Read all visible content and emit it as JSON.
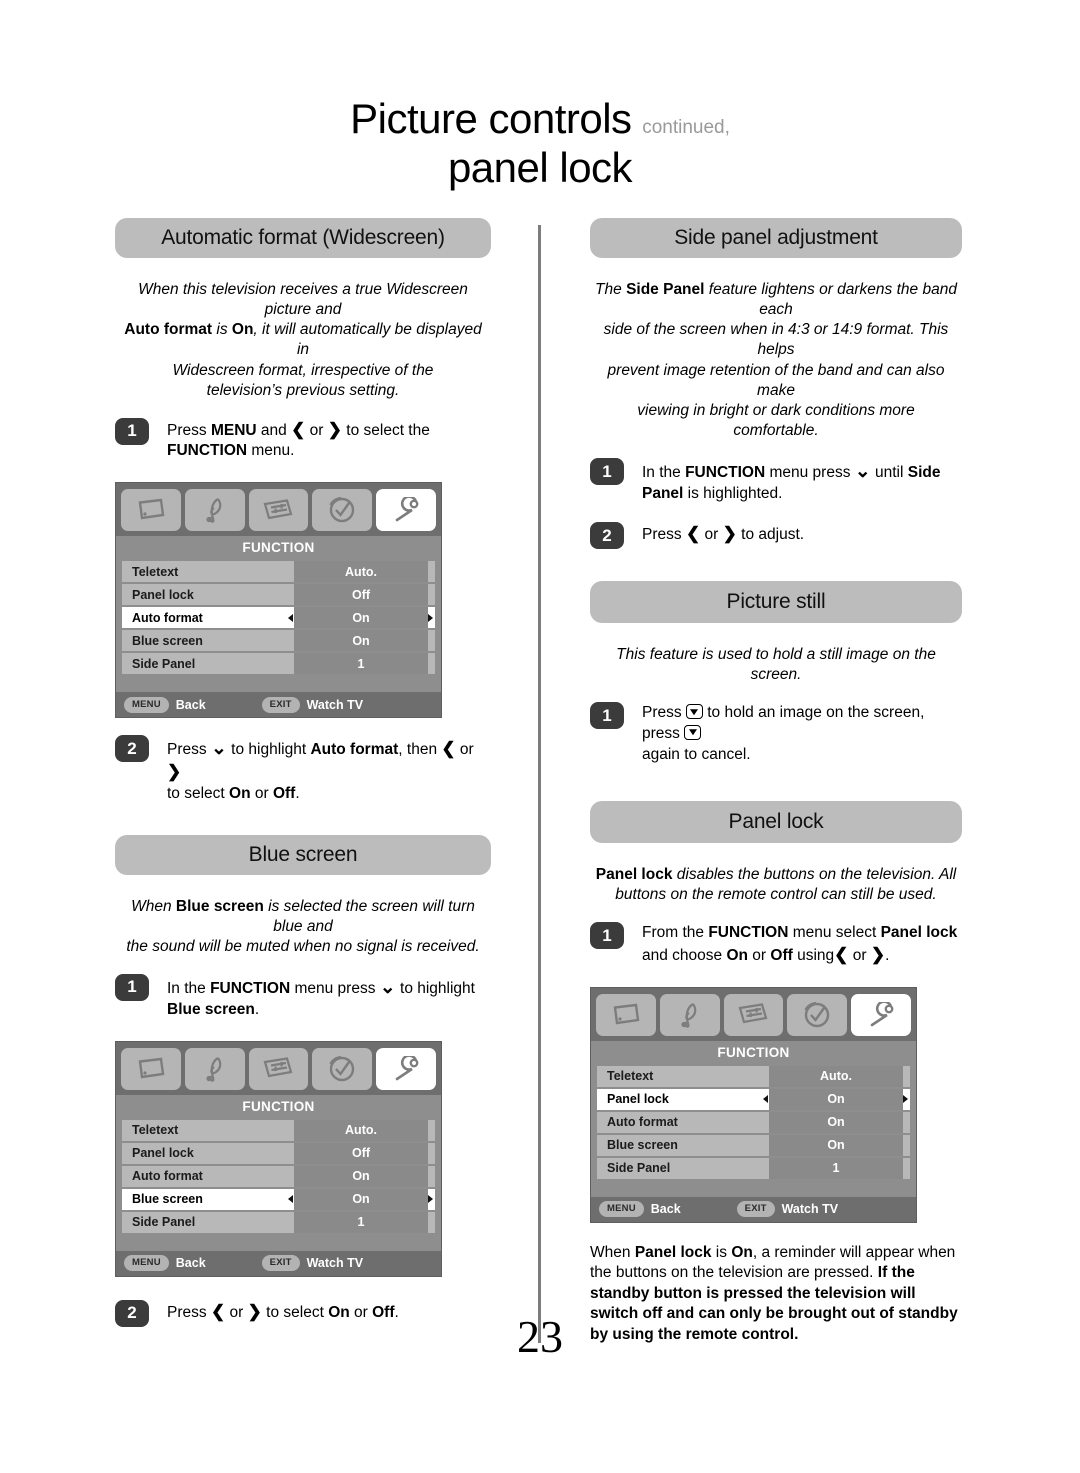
{
  "header": {
    "title_main": "Picture controls",
    "title_continued": "continued,",
    "title_sub": "panel lock"
  },
  "page_number": "23",
  "left_column": {
    "section_auto_format": {
      "heading": "Automatic format (Widescreen)",
      "intro_l1": "When this television receives a true Widescreen picture and",
      "intro_l2_b1": "Auto format",
      "intro_l2_m1": " is ",
      "intro_l2_b2": "On",
      "intro_l2_rest": ", it will automatically be displayed in",
      "intro_l3": "Widescreen format, irrespective of the",
      "intro_l4": "television’s previous setting.",
      "step1_num": "1",
      "step1_t1": "Press ",
      "step1_b1": "MENU",
      "step1_t2": " and ",
      "step1_t3": " or ",
      "step1_t4": " to select the",
      "step1_b2": "FUNCTION",
      "step1_t5": " menu.",
      "step2_num": "2",
      "step2_t1": "Press ",
      "step2_t2": " to highlight ",
      "step2_b1": "Auto format",
      "step2_t3": ", then ",
      "step2_t4": " or ",
      "step2_t5": "to select ",
      "step2_b2": "On",
      "step2_t6": " or ",
      "step2_b3": "Off",
      "step2_t7": "."
    },
    "section_blue_screen": {
      "heading": "Blue screen",
      "intro_l1a": "When ",
      "intro_l1b": "Blue screen",
      "intro_l1c": " is selected the screen will turn blue and",
      "intro_l2": "the sound will be muted when no signal is received.",
      "step1_num": "1",
      "step1_t1": "In the ",
      "step1_b1": "FUNCTION",
      "step1_t2": " menu press ",
      "step1_t3": " to highlight",
      "step1_b2": "Blue screen",
      "step1_t4": ".",
      "step2_num": "2",
      "step2_t1": "Press ",
      "step2_t2": " or ",
      "step2_t3": " to select ",
      "step2_b1": "On",
      "step2_t4": " or ",
      "step2_b2": "Off",
      "step2_t5": "."
    }
  },
  "right_column": {
    "section_side_panel": {
      "heading": "Side panel adjustment",
      "intro_l1a": "The ",
      "intro_l1b": "Side Panel",
      "intro_l1c": " feature lightens or darkens the band each",
      "intro_l2": "side of the screen when in 4:3 or 14:9 format. This helps",
      "intro_l3": "prevent image retention of the band and can also make",
      "intro_l4": "viewing in bright or dark conditions more comfortable.",
      "step1_num": "1",
      "step1_t1": "In the ",
      "step1_b1": "FUNCTION",
      "step1_t2": " menu press ",
      "step1_t3": " until ",
      "step1_b2": "Side",
      "step1_b3": "Panel",
      "step1_t4": " is highlighted.",
      "step2_num": "2",
      "step2_t1": "Press ",
      "step2_t2": " or ",
      "step2_t3": " to adjust."
    },
    "section_picture_still": {
      "heading": "Picture still",
      "intro_l1": "This feature is used to hold a still image on the screen.",
      "step1_num": "1",
      "step1_t1": "Press ",
      "step1_t2": " to hold an image on the screen, press ",
      "step1_t3": "again to cancel."
    },
    "section_panel_lock": {
      "heading": "Panel lock",
      "intro_l1a": "Panel lock",
      "intro_l1b": " disables the buttons on the television. All",
      "intro_l2": "buttons on the remote control can still be used.",
      "step1_num": "1",
      "step1_t1": "From the ",
      "step1_b1": "FUNCTION",
      "step1_t2": " menu select ",
      "step1_b2": "Panel lock",
      "step1_t3": "and choose ",
      "step1_b3": "On",
      "step1_t4": " or ",
      "step1_b4": "Off",
      "step1_t5": " using",
      "step1_t6": " or ",
      "step1_t7": ".",
      "note_t1": "When ",
      "note_b1": "Panel lock",
      "note_t2": " is ",
      "note_b2": "On",
      "note_t3": ", a reminder will appear when",
      "note_t4": "the buttons on the television are pressed. ",
      "note_b3": "If the standby button is pressed the television will switch off and can only be brought out of standby by using the remote control."
    }
  },
  "osd_menus": [
    {
      "id": "osd-auto-format",
      "title": "FUNCTION",
      "icons": [
        "picture-icon",
        "sound-icon",
        "feature-icon",
        "timer-icon",
        "setup-icon"
      ],
      "selected_icon_index": 4,
      "rows": [
        {
          "label": "Teletext",
          "value": "Auto.",
          "active": false
        },
        {
          "label": "Panel lock",
          "value": "Off",
          "active": false
        },
        {
          "label": "Auto format",
          "value": "On",
          "active": true
        },
        {
          "label": "Blue screen",
          "value": "On",
          "active": false
        },
        {
          "label": "Side Panel",
          "value": "1",
          "active": false
        }
      ],
      "footer": {
        "menu_key": "MENU",
        "menu_label": "Back",
        "exit_key": "EXIT",
        "exit_label": "Watch TV"
      }
    },
    {
      "id": "osd-blue-screen",
      "title": "FUNCTION",
      "icons": [
        "picture-icon",
        "sound-icon",
        "feature-icon",
        "timer-icon",
        "setup-icon"
      ],
      "selected_icon_index": 4,
      "rows": [
        {
          "label": "Teletext",
          "value": "Auto.",
          "active": false
        },
        {
          "label": "Panel lock",
          "value": "Off",
          "active": false
        },
        {
          "label": "Auto format",
          "value": "On",
          "active": false
        },
        {
          "label": "Blue screen",
          "value": "On",
          "active": true
        },
        {
          "label": "Side Panel",
          "value": "1",
          "active": false
        }
      ],
      "footer": {
        "menu_key": "MENU",
        "menu_label": "Back",
        "exit_key": "EXIT",
        "exit_label": "Watch TV"
      }
    },
    {
      "id": "osd-panel-lock",
      "title": "FUNCTION",
      "icons": [
        "picture-icon",
        "sound-icon",
        "feature-icon",
        "timer-icon",
        "setup-icon"
      ],
      "selected_icon_index": 4,
      "rows": [
        {
          "label": "Teletext",
          "value": "Auto.",
          "active": false
        },
        {
          "label": "Panel lock",
          "value": "On",
          "active": true
        },
        {
          "label": "Auto format",
          "value": "On",
          "active": false
        },
        {
          "label": "Blue screen",
          "value": "On",
          "active": false
        },
        {
          "label": "Side Panel",
          "value": "1",
          "active": false
        }
      ],
      "footer": {
        "menu_key": "MENU",
        "menu_label": "Back",
        "exit_key": "EXIT",
        "exit_label": "Watch TV"
      }
    }
  ],
  "colors": {
    "pill_gray": "#bcbcbc",
    "step_badge": "#3b3b3b",
    "osd_frame": "#6e6e6e",
    "osd_body": "#8e8e8e",
    "osd_row": "#b8b8b8",
    "osd_chip": "#8a8a8a",
    "osd_active": "#ffffff",
    "continued_gray": "#9a9a9a"
  }
}
